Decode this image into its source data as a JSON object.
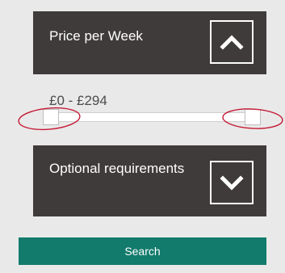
{
  "price_panel": {
    "title": "Price per Week",
    "toggle_icon": "chevron-up-icon"
  },
  "range": {
    "label": "£0 - £294",
    "min_value": 0,
    "max_value": 294
  },
  "optional_panel": {
    "title": "Optional requirements",
    "toggle_icon": "chevron-down-icon"
  },
  "search": {
    "label": "Search",
    "color": "#127b6c"
  },
  "colors": {
    "panel_bg": "#3f3b3a",
    "page_bg": "#e9e9e9",
    "annotation": "#c51a35"
  }
}
